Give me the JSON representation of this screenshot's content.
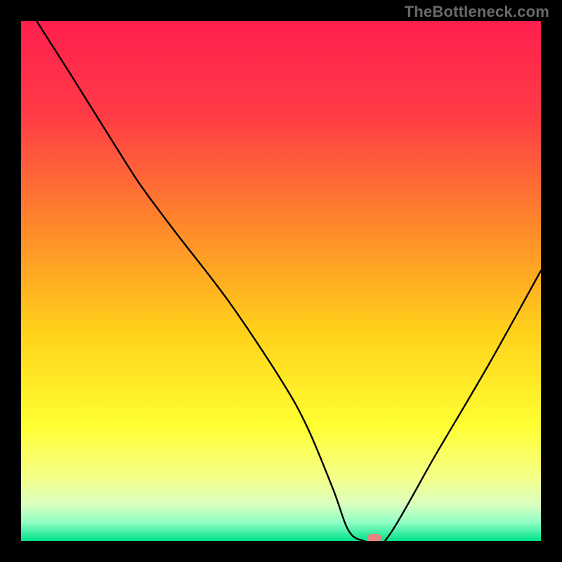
{
  "watermark": "TheBottleneck.com",
  "chart_data": {
    "type": "line",
    "title": "",
    "xlabel": "",
    "ylabel": "",
    "xlim": [
      0,
      100
    ],
    "ylim": [
      0,
      100
    ],
    "x": [
      3,
      10,
      20,
      24,
      30,
      40,
      50,
      55,
      60,
      63,
      66,
      70,
      80,
      90,
      100
    ],
    "values": [
      100,
      89,
      73,
      67,
      59,
      46,
      31,
      22,
      10,
      2,
      0,
      0,
      17,
      34,
      52
    ],
    "marker": {
      "x": 68,
      "y": 0
    },
    "gradient_stops": [
      {
        "offset": 0.0,
        "color": "#ff1f4d"
      },
      {
        "offset": 0.18,
        "color": "#ff3b46"
      },
      {
        "offset": 0.4,
        "color": "#ff8a2a"
      },
      {
        "offset": 0.6,
        "color": "#ffd21a"
      },
      {
        "offset": 0.78,
        "color": "#ffff33"
      },
      {
        "offset": 0.88,
        "color": "#f4ff8a"
      },
      {
        "offset": 0.93,
        "color": "#d9ffc0"
      },
      {
        "offset": 0.965,
        "color": "#8effc3"
      },
      {
        "offset": 1.0,
        "color": "#00e28a"
      }
    ]
  }
}
